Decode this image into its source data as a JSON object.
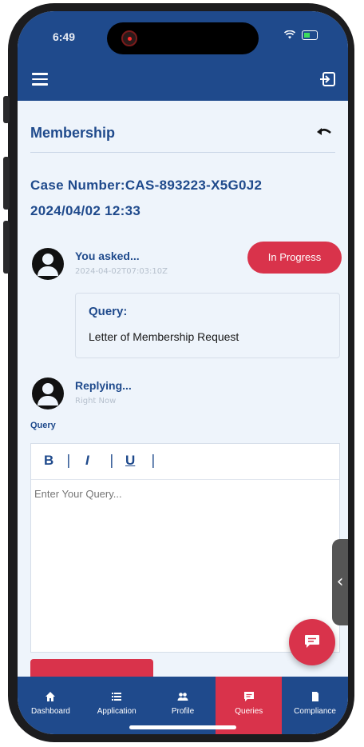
{
  "status_bar": {
    "time": "6:49"
  },
  "page": {
    "title": "Membership"
  },
  "case": {
    "number": "Case Number:CAS-893223-X5G0J2",
    "date": "2024/04/02 12:33"
  },
  "thread": {
    "asked_label": "You asked...",
    "asked_time": "2024-04-02T07:03:10Z",
    "status": "In Progress",
    "query_title": "Query:",
    "query_text": "Letter of Membership Request",
    "reply_label": "Replying...",
    "reply_time": "Right Now"
  },
  "editor": {
    "field_label": "Query",
    "bold": "B",
    "italic": "I",
    "underline": "U",
    "separator": "|",
    "placeholder": "Enter Your Query..."
  },
  "nav": {
    "items": [
      {
        "label": "Dashboard",
        "icon": "home-icon"
      },
      {
        "label": "Application",
        "icon": "list-icon"
      },
      {
        "label": "Profile",
        "icon": "people-icon"
      },
      {
        "label": "Queries",
        "icon": "chat-icon",
        "active": true
      },
      {
        "label": "Compliance",
        "icon": "document-icon"
      }
    ]
  },
  "colors": {
    "primary": "#1f4a8c",
    "accent": "#d9334b",
    "background": "#eef4fb"
  }
}
